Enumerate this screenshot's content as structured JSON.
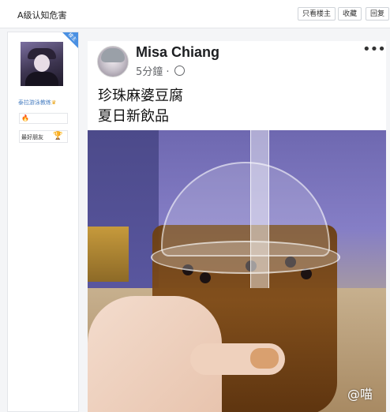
{
  "topbar": {
    "title": "A级认知危害",
    "buttons": {
      "only_op": "只看楼主",
      "favorite": "收藏",
      "reply": "回复"
    }
  },
  "sidebar": {
    "corner_badge": "楼主",
    "username": "泰拉游泳教练",
    "username_suffix": "♛",
    "badge": "🔥",
    "friend_label": "最好朋友",
    "trophy": "🏆"
  },
  "post": {
    "author": "Misa Chiang",
    "time": "5分鐘 ·",
    "more": "•••",
    "text_line1": "珍珠麻婆豆腐",
    "text_line2": "夏日新飲品"
  },
  "watermark": "@喵",
  "colors": {
    "accent": "#4a90e2",
    "link": "#4a7fc1",
    "meta": "#65676b"
  }
}
